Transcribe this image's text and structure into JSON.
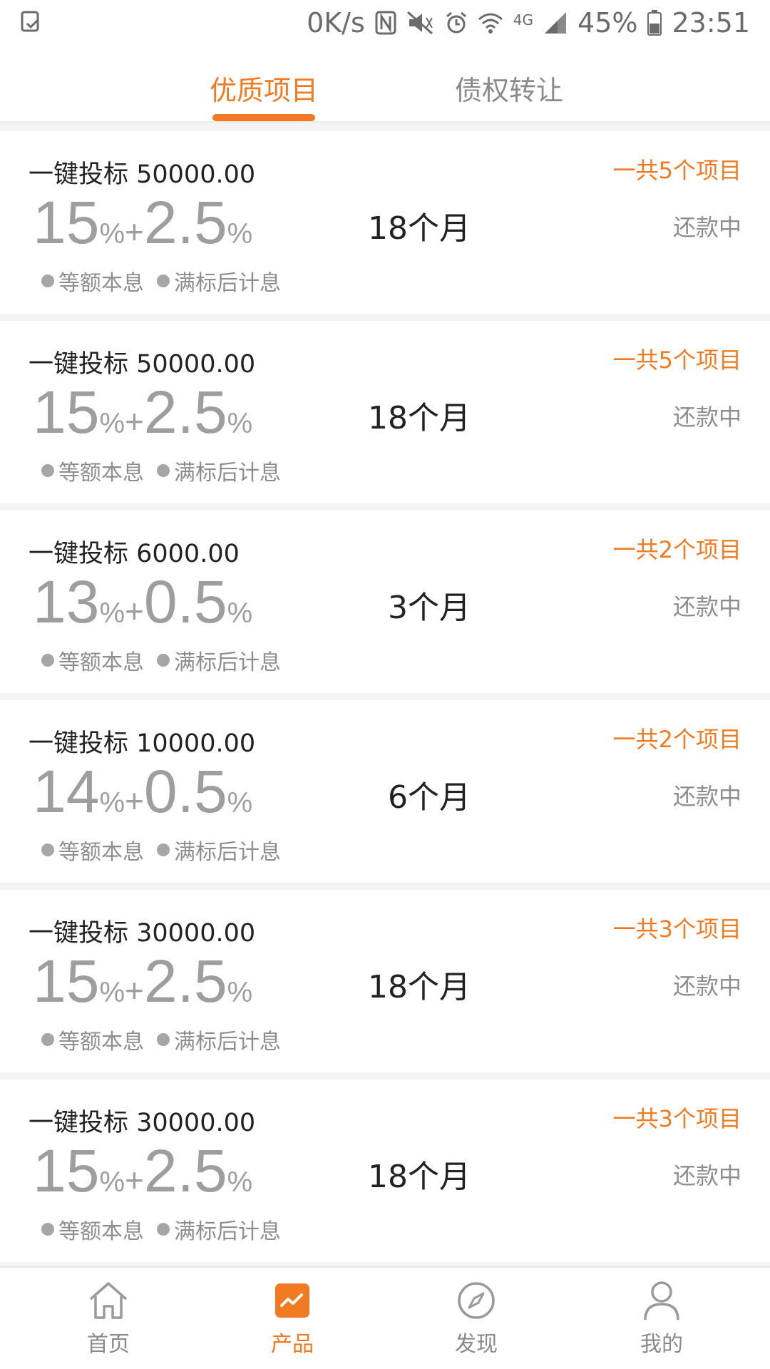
{
  "status_bar": {
    "speed": "0K/s",
    "network": "4G",
    "battery": "45%",
    "time": "23:51"
  },
  "tabs": [
    {
      "label": "优质项目",
      "active": true
    },
    {
      "label": "债权转让",
      "active": false
    }
  ],
  "items": [
    {
      "title": "一键投标 50000.00",
      "count": "一共5个项目",
      "rate_base": "15",
      "rate_extra": "2.5",
      "term": "18个月",
      "status": "还款中",
      "tags": [
        "等额本息",
        "满标后计息"
      ]
    },
    {
      "title": "一键投标 50000.00",
      "count": "一共5个项目",
      "rate_base": "15",
      "rate_extra": "2.5",
      "term": "18个月",
      "status": "还款中",
      "tags": [
        "等额本息",
        "满标后计息"
      ]
    },
    {
      "title": "一键投标 6000.00",
      "count": "一共2个项目",
      "rate_base": "13",
      "rate_extra": "0.5",
      "term": "3个月",
      "status": "还款中",
      "tags": [
        "等额本息",
        "满标后计息"
      ]
    },
    {
      "title": "一键投标 10000.00",
      "count": "一共2个项目",
      "rate_base": "14",
      "rate_extra": "0.5",
      "term": "6个月",
      "status": "还款中",
      "tags": [
        "等额本息",
        "满标后计息"
      ]
    },
    {
      "title": "一键投标 30000.00",
      "count": "一共3个项目",
      "rate_base": "15",
      "rate_extra": "2.5",
      "term": "18个月",
      "status": "还款中",
      "tags": [
        "等额本息",
        "满标后计息"
      ]
    },
    {
      "title": "一键投标 30000.00",
      "count": "一共3个项目",
      "rate_base": "15",
      "rate_extra": "2.5",
      "term": "18个月",
      "status": "还款中",
      "tags": [
        "等额本息",
        "满标后计息"
      ]
    }
  ],
  "rate_symbols": {
    "percent": "%",
    "plus": "+"
  },
  "bottom_nav": [
    {
      "label": "首页",
      "icon": "home-icon",
      "active": false
    },
    {
      "label": "产品",
      "icon": "product-chart-icon",
      "active": true
    },
    {
      "label": "发现",
      "icon": "compass-icon",
      "active": false
    },
    {
      "label": "我的",
      "icon": "user-icon",
      "active": false
    }
  ],
  "colors": {
    "accent": "#f07b22",
    "muted": "#9e9e9e"
  }
}
